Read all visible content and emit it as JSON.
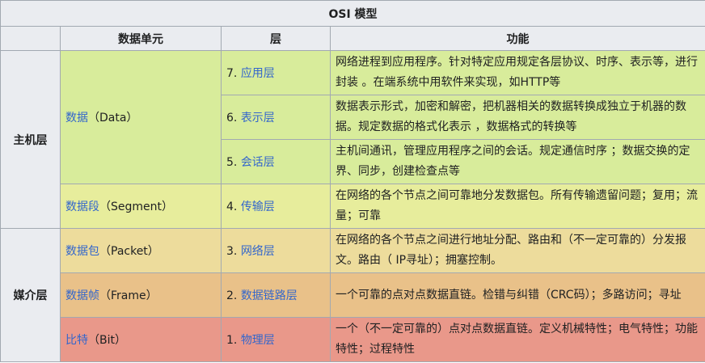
{
  "table": {
    "caption": "OSI 模型",
    "headers": [
      "数据单元",
      "层",
      "功能"
    ],
    "groups": {
      "host": "主机层",
      "media": "媒介层"
    },
    "units": {
      "data": {
        "name": "数据",
        "suffix": "（Data）"
      },
      "segment": {
        "name": "数据段",
        "suffix": "（Segment）"
      },
      "packet": {
        "name": "数据包",
        "suffix": "（Packet）"
      },
      "frame": {
        "name": "数据帧",
        "suffix": "（Frame）"
      },
      "bit": {
        "name": "比特",
        "suffix": "（Bit）"
      }
    },
    "layers": [
      {
        "num": "7. ",
        "name": "应用层",
        "func": "网络进程到应用程序。针对特定应用规定各层协议、时序、表示等，进行封装 。在端系统中用软件来实现，如HTTP等"
      },
      {
        "num": "6. ",
        "name": "表示层",
        "func": "数据表示形式，加密和解密，把机器相关的数据转换成独立于机器的数据。规定数据的格式化表示 ，数据格式的转换等"
      },
      {
        "num": "5. ",
        "name": "会话层",
        "func": "主机间通讯，管理应用程序之间的会话。规定通信时序 ；数据交换的定界、同步，创建检查点等"
      },
      {
        "num": "4. ",
        "name": "传输层",
        "func": "在网络的各个节点之间可靠地分发数据包。所有传输遗留问题；复用；流量；可靠"
      },
      {
        "num": "3. ",
        "name": "网络层",
        "func": "在网络的各个节点之间进行地址分配、路由和（不一定可靠的）分发报文。路由（ IP寻址）；拥塞控制。"
      },
      {
        "num": "2. ",
        "name": "数据链路层",
        "func": "一个可靠的点对点数据直链。检错与纠错（CRC码）；多路访问；寻址"
      },
      {
        "num": "1. ",
        "name": "物理层",
        "func": "一个（不一定可靠的）点对点数据直链。定义机械特性；电气特性；功能特性；过程特性"
      }
    ],
    "colors": {
      "header_bg": "#eaecf0",
      "border": "#a2a9b1",
      "link": "#3366cc",
      "application_rows": "#d8ec9b",
      "transport_row": "#e7ed9c",
      "network_row": "#eddc9c",
      "datalink_row": "#e9c189",
      "physical_row": "#e9988a"
    }
  }
}
